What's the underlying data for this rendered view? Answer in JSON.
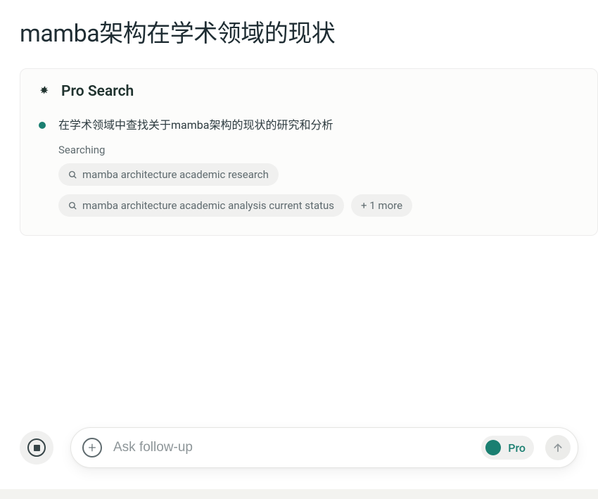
{
  "title": "mamba架构在学术领域的现状",
  "proSearch": {
    "label": "Pro Search",
    "step1": "在学术领域中查找关于mamba架构的现状的研究和分析",
    "searchingLabel": "Searching",
    "chips": [
      "mamba architecture academic research",
      "mamba architecture academic analysis current status"
    ],
    "moreChip": "+ 1 more"
  },
  "inputBar": {
    "placeholder": "Ask follow-up",
    "proLabel": "Pro"
  },
  "colors": {
    "accent": "#1a7f71"
  }
}
